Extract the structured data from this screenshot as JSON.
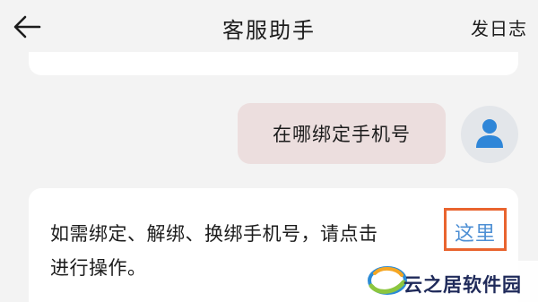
{
  "header": {
    "title": "客服助手",
    "log_label": "发日志"
  },
  "chat": {
    "user_message": "在哪绑定手机号",
    "reply_line1": "如需绑定、解绑、换绑手机号，请点击",
    "reply_link": "这里",
    "reply_line2": "进行操作。"
  },
  "watermark": {
    "text": "云之居软件园"
  },
  "colors": {
    "background": "#f3f3f3",
    "user_bubble": "#ecdede",
    "link": "#4d8fd4",
    "highlight_box": "#e9642f",
    "avatar_icon": "#2f86d8"
  },
  "icons": {
    "back": "arrow-left-icon",
    "avatar": "user-icon",
    "watermark_logo": "swirl-logo-icon"
  }
}
